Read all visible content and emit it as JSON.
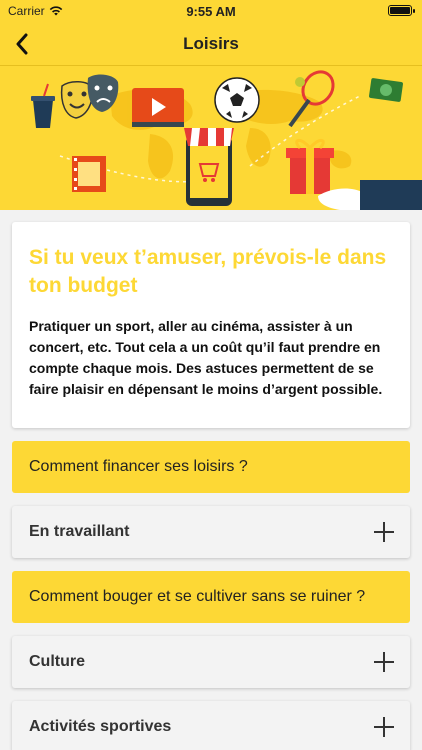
{
  "status_bar": {
    "carrier": "Carrier",
    "time": "9:55 AM"
  },
  "nav": {
    "title": "Loisirs",
    "back_icon": "chevron-left-icon"
  },
  "banner": {
    "icons": [
      "cup-icon",
      "theater-masks-icon",
      "video-play-icon",
      "soccer-ball-icon",
      "tennis-racket-icon",
      "dollar-bill-icon",
      "film-strip-icon",
      "smartphone-shop-icon",
      "gift-box-icon",
      "hand-icon",
      "world-map-icon"
    ]
  },
  "intro": {
    "title": "Si tu veux t’amuser, prévois-le dans ton budget",
    "body": "Pratiquer un sport, aller au cinéma, assister à un concert, etc. Tout cela a un coût qu’il faut prendre en compte chaque mois. Des astuces permettent de se faire plaisir en dépensant le moins d’argent possible."
  },
  "sections": [
    {
      "label": "Comment financer ses loisirs ?"
    },
    {
      "label": "En travaillant"
    },
    {
      "label": "Comment bouger et se cultiver sans se ruiner ?"
    },
    {
      "label": "Culture"
    },
    {
      "label": "Activités sportives"
    }
  ],
  "colors": {
    "accent": "#fdd835",
    "card": "#ffffff",
    "row": "#f3f3f3"
  }
}
